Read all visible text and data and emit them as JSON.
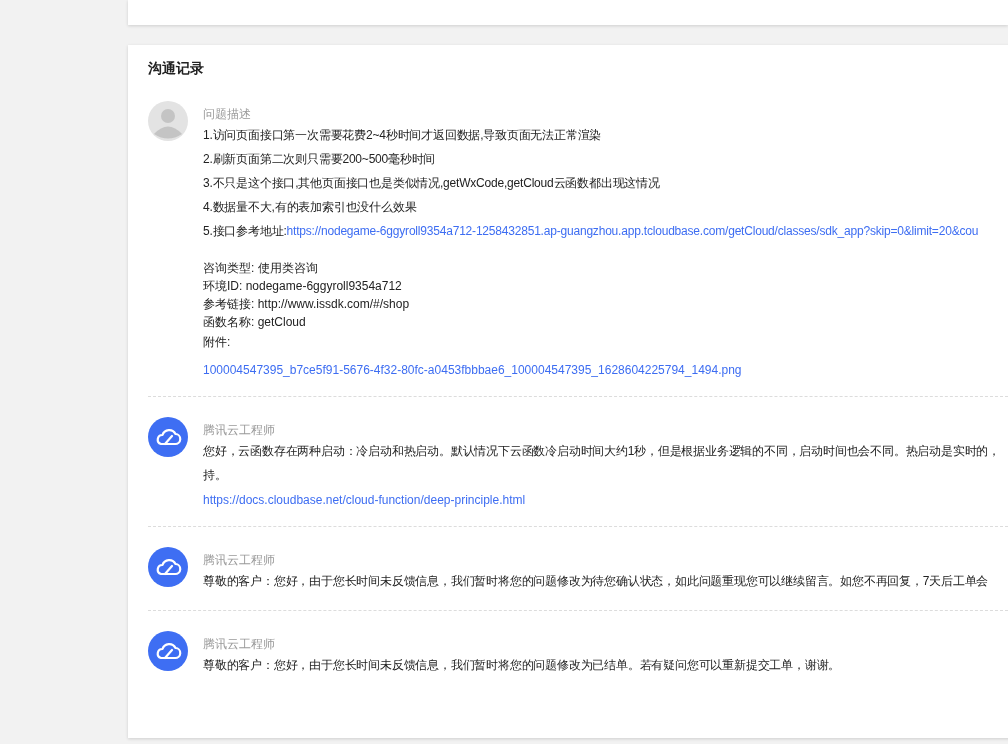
{
  "section_title": "沟通记录",
  "messages": [
    {
      "kind": "customer",
      "author": "问题描述",
      "lines": [
        "1.访问页面接口第一次需要花费2~4秒时间才返回数据,导致页面无法正常渲染",
        "2.刷新页面第二次则只需要200~500毫秒时间",
        "3.不只是这个接口,其他页面接口也是类似情况,getWxCode,getCloud云函数都出现这情况",
        "4.数据量不大,有的表加索引也没什么效果"
      ],
      "link_line": {
        "label": "5.接口参考地址:",
        "url": "https://nodegame-6ggyroll9354a712-1258432851.ap-guangzhou.app.tcloudbase.com/getCloud/classes/sdk_app?skip=0&limit=20&cou"
      },
      "fields": [
        "咨询类型: 使用类咨询",
        "环境ID: nodegame-6ggyroll9354a712",
        "参考链接: http://www.issdk.com/#/shop",
        "函数名称: getCloud"
      ],
      "attachment_label": "附件:",
      "attachment": "100004547395_b7ce5f91-5676-4f32-80fc-a0453fbbbae6_100004547395_1628604225794_1494.png"
    },
    {
      "kind": "engineer",
      "author": "腾讯云工程师",
      "lines": [
        "您好，云函数存在两种启动：冷启动和热启动。默认情况下云函数冷启动时间大约1秒，但是根据业务逻辑的不同，启动时间也会不同。热启动是实时的，",
        "持。"
      ],
      "url": "https://docs.cloudbase.net/cloud-function/deep-principle.html"
    },
    {
      "kind": "engineer",
      "author": "腾讯云工程师",
      "lines": [
        "尊敬的客户：您好，由于您长时间未反馈信息，我们暂时将您的问题修改为待您确认状态，如此问题重现您可以继续留言。如您不再回复，7天后工单会"
      ]
    },
    {
      "kind": "engineer",
      "author": "腾讯云工程师",
      "lines": [
        "尊敬的客户：您好，由于您长时间未反馈信息，我们暂时将您的问题修改为已结单。若有疑问您可以重新提交工单，谢谢。"
      ]
    }
  ]
}
